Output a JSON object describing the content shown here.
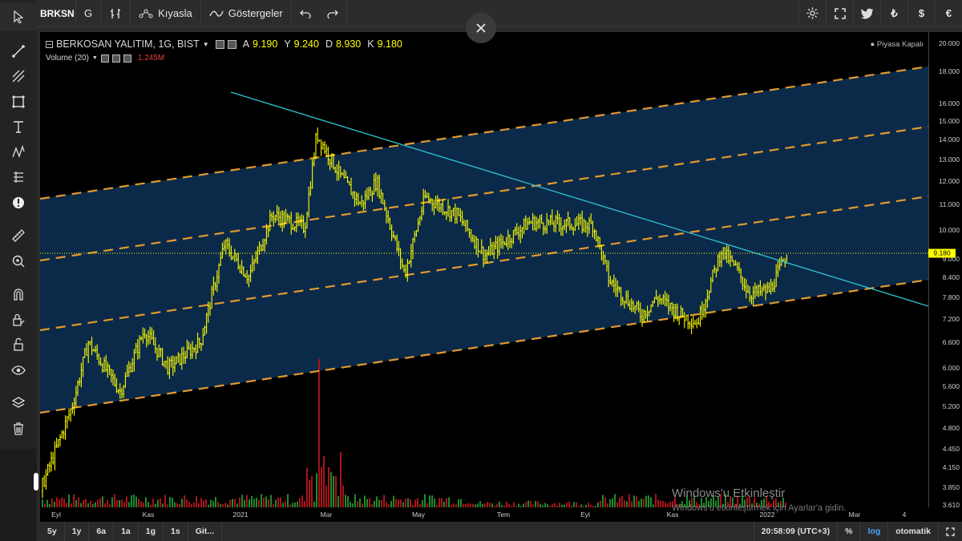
{
  "toolbar": {
    "symbol": "BRKSN",
    "btn_g": "G",
    "compare": "Kıyasla",
    "indicators": "Göstergeler",
    "currencies": [
      "₺",
      "$",
      "€"
    ]
  },
  "legend": {
    "title": "BERKOSAN YALITIM, 1G, BIST",
    "open_label": "A",
    "open": "9.190",
    "high_label": "Y",
    "high": "9.240",
    "low_label": "D",
    "low": "8.930",
    "close_label": "K",
    "close": "9.180",
    "volume_title": "Volume (20)",
    "volume_value": "1.245M",
    "market_status": "● Piyasa Kapalı"
  },
  "price_tag": "9.180",
  "y_ticks": [
    "20.000",
    "18.000",
    "16.000",
    "15.000",
    "14.000",
    "13.000",
    "12.000",
    "11.000",
    "10.000",
    "9.000",
    "8.400",
    "7.800",
    "7.200",
    "6.600",
    "6.000",
    "5.600",
    "5.200",
    "4.800",
    "4.450",
    "4.150",
    "3.850",
    "3.610"
  ],
  "x_ticks": [
    "Eyl",
    "Kas",
    "2021",
    "Mar",
    "May",
    "Tem",
    "Eyl",
    "Kas",
    "2022",
    "Mar",
    "4"
  ],
  "watermark": {
    "title": "Windows'u Etkinleştir",
    "subtitle": "Windows'u etkinleştirmek için Ayarlar'a gidin."
  },
  "bottombar": {
    "ranges": [
      "5y",
      "1y",
      "6a",
      "1a",
      "1g",
      "1s",
      "Git..."
    ],
    "time": "20:58:09 (UTC+3)",
    "percent": "%",
    "log": "log",
    "auto": "otomatik"
  },
  "colors": {
    "candle": "#ffff00",
    "channel_fill": "#0b2a4a",
    "channel_line": "#e39a2d",
    "trendline": "#2ec4d6",
    "volume_up": "#1f8a2c",
    "volume_down": "#a8141b"
  },
  "chart_data": {
    "type": "line",
    "ylabel": "",
    "ylim": [
      3.6,
      20
    ],
    "scale": "log",
    "last_close": 9.18,
    "x": [
      "2020-08",
      "2020-09",
      "2020-10",
      "2020-11",
      "2020-12",
      "2021-01",
      "2021-02",
      "2021-03",
      "2021-04",
      "2021-05",
      "2021-06",
      "2021-07",
      "2021-08",
      "2021-09",
      "2021-10",
      "2021-11",
      "2021-12",
      "2022-01"
    ],
    "series": [
      {
        "values": [
          3.9,
          4.6,
          5.8,
          6.1,
          6.4,
          9.0,
          11.0,
          14.5,
          10.5,
          11.5,
          10.5,
          9.8,
          10.0,
          9.5,
          7.6,
          7.3,
          9.4,
          9.18
        ]
      }
    ]
  }
}
